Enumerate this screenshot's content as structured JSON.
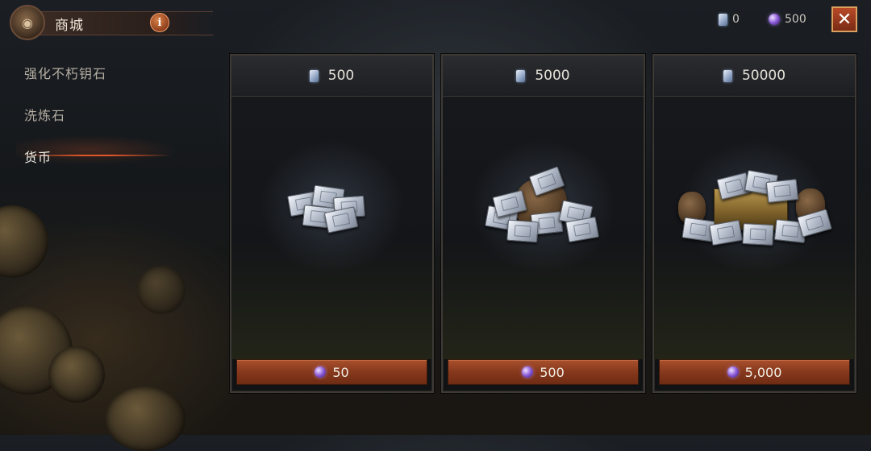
{
  "header": {
    "title": "商城",
    "info_symbol": "i",
    "emblem_icon": "coin-bag-icon"
  },
  "currencies": [
    {
      "icon": "silver-tile-icon",
      "value": "0"
    },
    {
      "icon": "purple-orb-icon",
      "value": "500"
    }
  ],
  "close_symbol": "✕",
  "sidebar": {
    "items": [
      {
        "label": "强化不朽钥石",
        "active": false
      },
      {
        "label": "洗炼石",
        "active": false
      },
      {
        "label": "货币",
        "active": true
      }
    ]
  },
  "cards": [
    {
      "amount": "500",
      "price": "50",
      "art": "tile-small-stack"
    },
    {
      "amount": "5000",
      "price": "500",
      "art": "tile-sack"
    },
    {
      "amount": "50000",
      "price": "5,000",
      "art": "tile-chest-hoard"
    }
  ],
  "colors": {
    "accent_orange": "#e0562a",
    "button_red": "#86381c",
    "close_border": "#d9a060"
  }
}
